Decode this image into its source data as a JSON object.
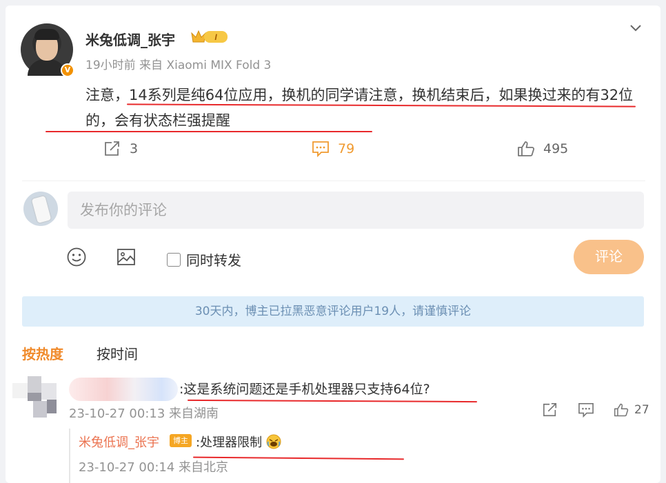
{
  "post": {
    "author": "米兔低调_张宇",
    "level": "I",
    "verified_badge": "V",
    "time": "19小时前",
    "source": "来自 Xiaomi MIX Fold 3",
    "text": "注意，14系列是纯64位应用，换机的同学请注意，换机结束后，如果换过来的有32位的，会有状态栏强提醒",
    "repost_count": "3",
    "comment_count": "79",
    "like_count": "495"
  },
  "composer": {
    "placeholder": "发布你的评论",
    "repost_label": "同时转发",
    "submit_label": "评论"
  },
  "notice": "30天内，博主已拉黑恶意评论用户19人，请谨慎评论",
  "sort": {
    "hot": "按热度",
    "time": "按时间"
  },
  "comments": [
    {
      "text": ":这是系统问题还是手机处理器只支持64位?",
      "time": "23-10-27 00:13",
      "location": "来自湖南",
      "like_count": "27",
      "reply": {
        "author": "米兔低调_张宇",
        "badge": "博主",
        "text": ":处理器限制",
        "time": "23-10-27 00:14",
        "location": "来自北京"
      }
    }
  ],
  "colors": {
    "accent": "#f08a2b",
    "link": "#eb7350",
    "notice_bg": "#deeefa",
    "annotation": "#e8292b"
  },
  "icons": [
    "chevron-down-icon",
    "crown-icon",
    "repost-icon",
    "comment-icon",
    "like-icon",
    "emoji-icon",
    "image-icon",
    "laugh-emoji-icon"
  ]
}
